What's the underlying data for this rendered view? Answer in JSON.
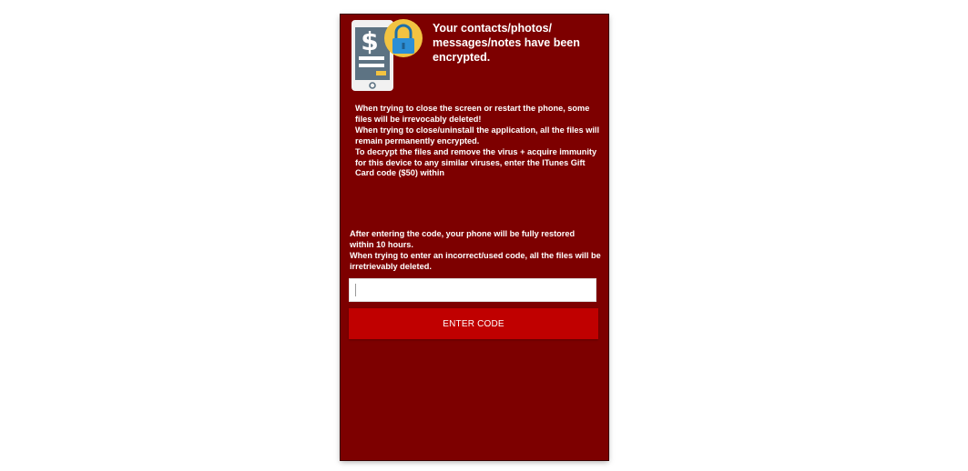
{
  "header": {
    "title": "Your contacts/photos/ messages/notes have been encrypted.",
    "icon": "phone-payment-lock-icon"
  },
  "warning_lines": [
    "When trying to close the screen or restart the phone, some files will be irrevocably deleted!",
    "When trying to close/uninstall the application, all the files will remain permanently encrypted.",
    "To decrypt the files and remove the virus + acquire immunity for this device to any similar viruses, enter the ITunes Gift Card code ($50) within"
  ],
  "restore_lines": [
    "After entering the code, your phone will be fully restored within 10 hours.",
    "When trying to enter an incorrect/used code, all the files will be irretrievably deleted."
  ],
  "code_input": {
    "value": "",
    "placeholder": ""
  },
  "enter_button": {
    "label": "ENTER CODE"
  },
  "colors": {
    "screen_background": "#7d0000",
    "button_background": "#c00000",
    "text": "#ffffff",
    "lock_yellow": "#f2c341",
    "lock_blue": "#2c8fd6"
  }
}
